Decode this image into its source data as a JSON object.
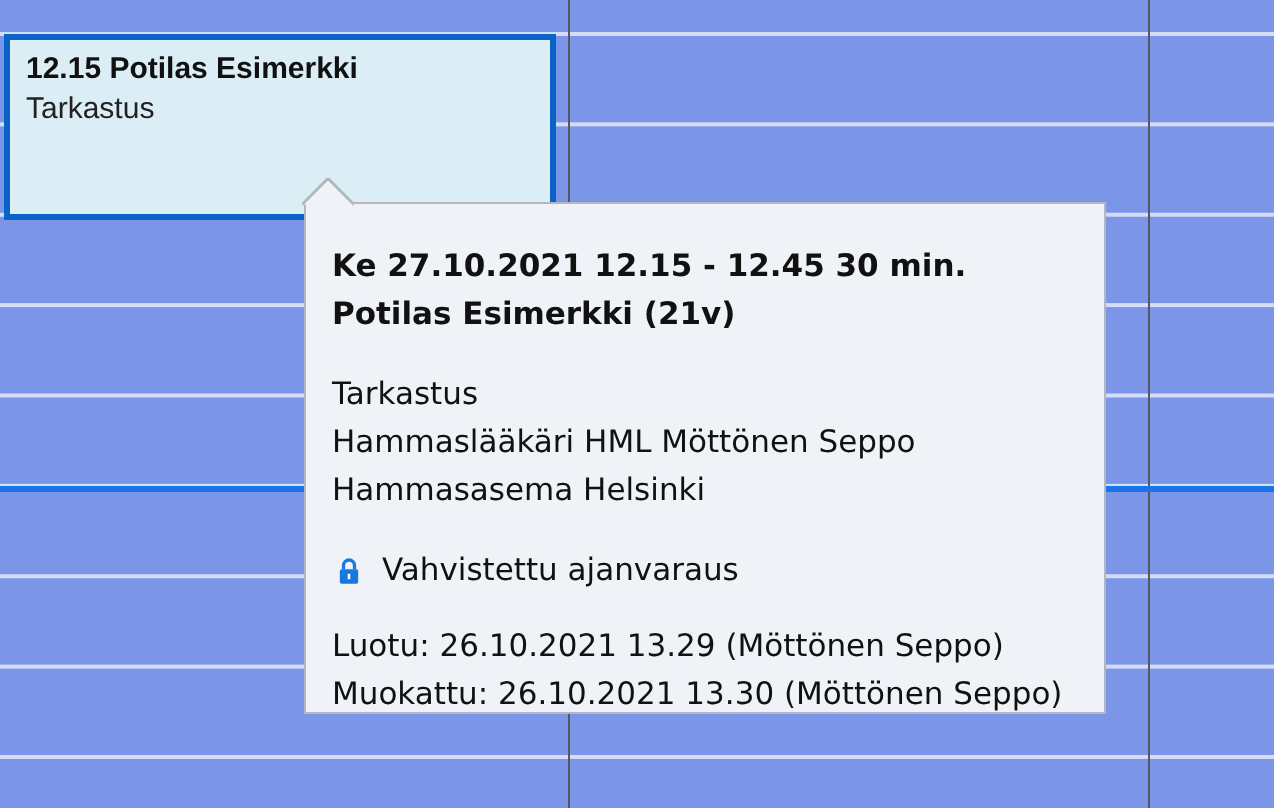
{
  "calendar": {
    "columns": [
      {
        "appointments": [
          {
            "title": "12.15 Potilas Esimerkki",
            "type": "Tarkastus",
            "selected": true
          }
        ]
      },
      {},
      {}
    ]
  },
  "tooltip": {
    "heading": [
      "Ke 27.10.2021 12.15 - 12.45 30 min.",
      "Potilas Esimerkki (21v)"
    ],
    "details": [
      "Tarkastus",
      "Hammaslääkäri HML Möttönen Seppo",
      "Hammasasema Helsinki"
    ],
    "status": "Vahvistettu ajanvaraus",
    "history": [
      "Luotu: 26.10.2021 13.29 (Möttönen Seppo)",
      "Muokattu: 26.10.2021 13.30 (Möttönen Seppo)"
    ]
  }
}
